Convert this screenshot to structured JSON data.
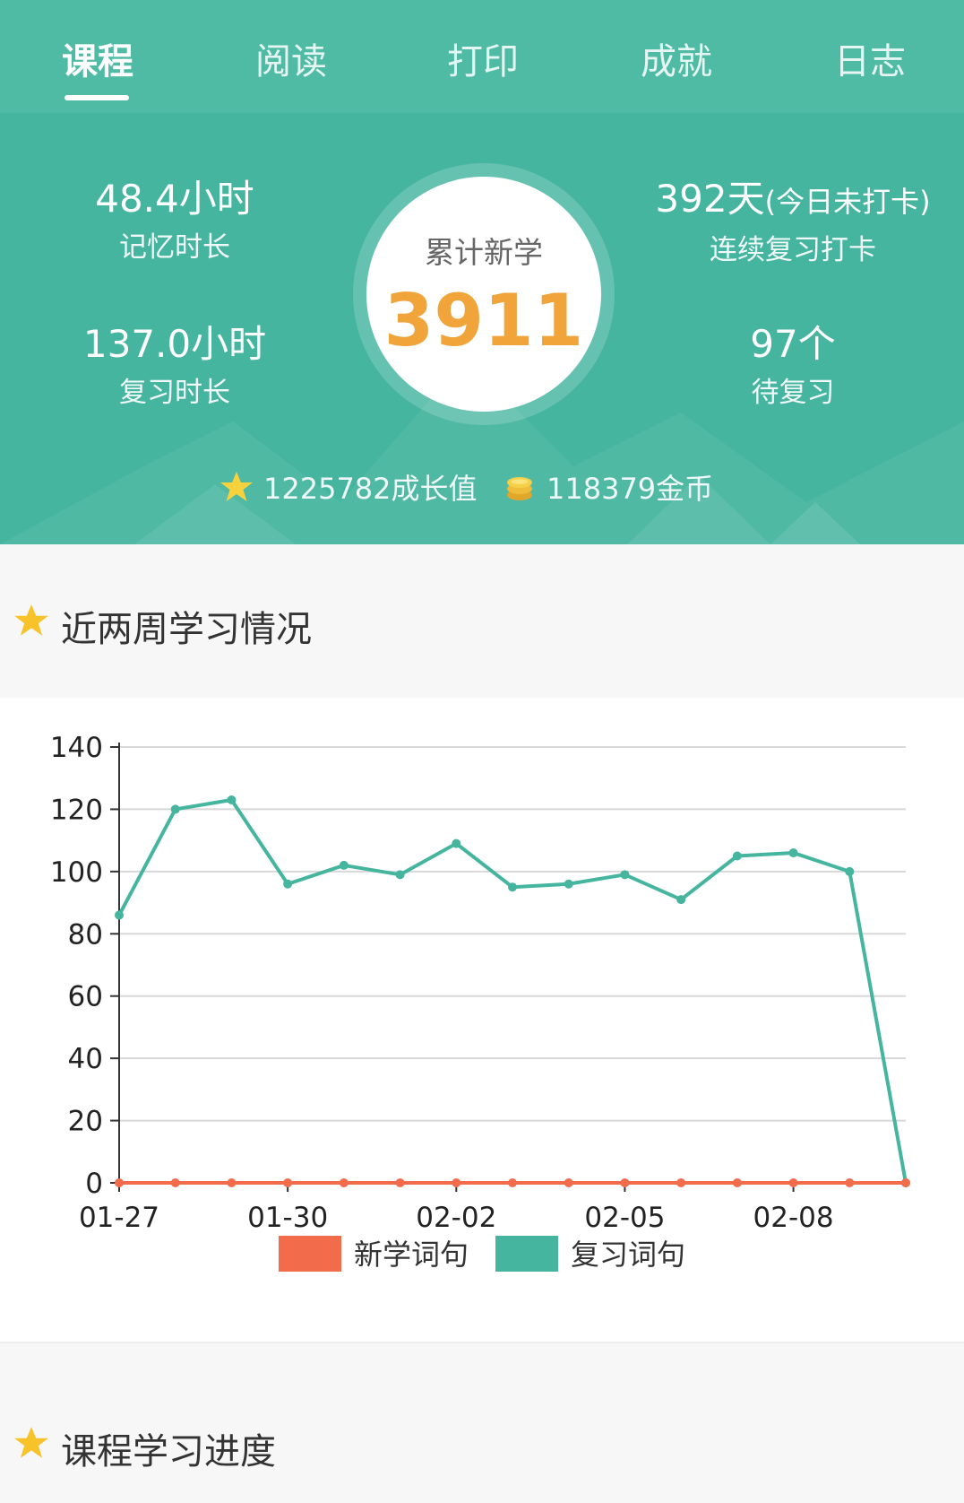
{
  "tabs": [
    "课程",
    "阅读",
    "打印",
    "成就",
    "日志"
  ],
  "active_tab": 0,
  "stats": {
    "memory_time": {
      "value": "48.4小时",
      "label": "记忆时长"
    },
    "review_time": {
      "value": "137.0小时",
      "label": "复习时长"
    },
    "streak": {
      "value": "392天",
      "suffix": "(今日未打卡)",
      "label": "连续复习打卡"
    },
    "pending": {
      "value": "97个",
      "label": "待复习"
    },
    "total_new": {
      "label": "累计新学",
      "value": "3911"
    }
  },
  "rewards": {
    "growth": "1225782成长值",
    "coins": "118379金币"
  },
  "section1_title": "近两周学习情况",
  "section2_title": "课程学习进度",
  "colors": {
    "header_bg": "#45b59f",
    "accent_orange": "#f0a43a",
    "series_new": "#f26b4a",
    "series_review": "#45b59f"
  },
  "chart_data": {
    "type": "line",
    "x": [
      "01-27",
      "01-28",
      "01-29",
      "01-30",
      "01-31",
      "02-01",
      "02-02",
      "02-03",
      "02-04",
      "02-05",
      "02-06",
      "02-07",
      "02-08",
      "02-09",
      "02-10"
    ],
    "x_tick_labels": [
      "01-27",
      "01-30",
      "02-02",
      "02-05",
      "02-08"
    ],
    "ylim": [
      0,
      140
    ],
    "y_ticks": [
      0,
      20,
      40,
      60,
      80,
      100,
      120,
      140
    ],
    "grid": true,
    "legend_position": "bottom-center",
    "series": [
      {
        "name": "新学词句",
        "color": "#f26b4a",
        "values": [
          0,
          0,
          0,
          0,
          0,
          0,
          0,
          0,
          0,
          0,
          0,
          0,
          0,
          0,
          0
        ]
      },
      {
        "name": "复习词句",
        "color": "#45b59f",
        "values": [
          86,
          120,
          123,
          96,
          102,
          99,
          109,
          95,
          96,
          99,
          91,
          105,
          106,
          100,
          0
        ]
      }
    ]
  }
}
